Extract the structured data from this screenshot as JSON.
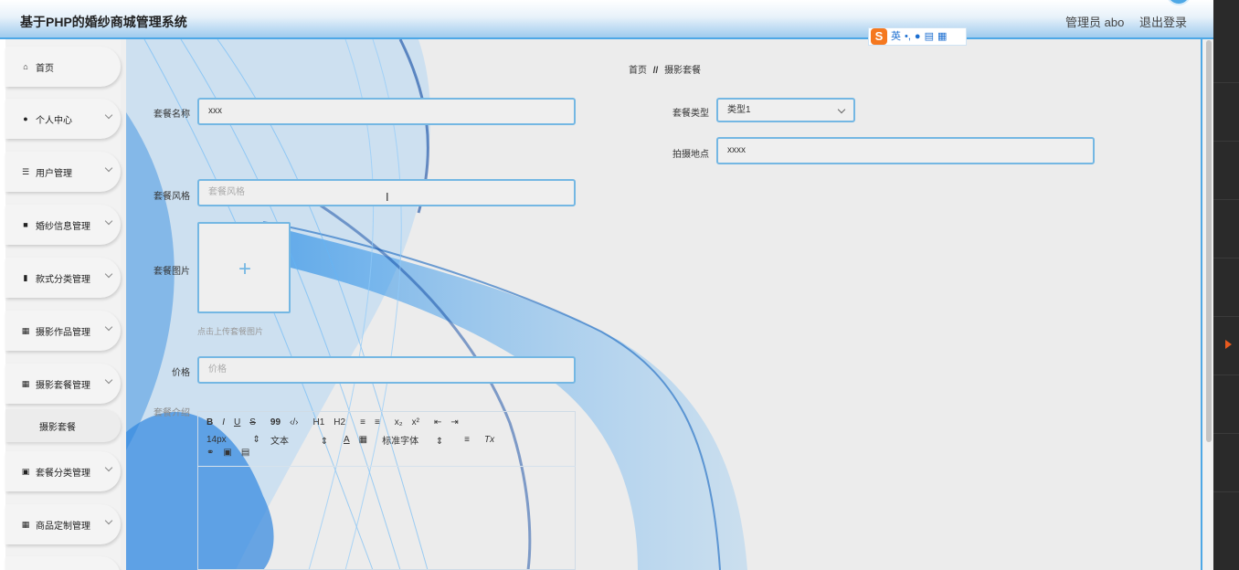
{
  "header": {
    "title": "基于PHP的婚纱商城管理系统",
    "user_label": "管理员 abo",
    "logout_label": "退出登录"
  },
  "ime_toolbar": {
    "logo": "S",
    "mode": "英",
    "punct": "•,"
  },
  "sidebar": {
    "items": [
      {
        "label": "首页",
        "icon": "home-icon",
        "expandable": false
      },
      {
        "label": "个人中心",
        "icon": "person-icon",
        "expandable": true
      },
      {
        "label": "用户管理",
        "icon": "list-icon",
        "expandable": true
      },
      {
        "label": "婚纱信息管理",
        "icon": "briefcase-icon",
        "expandable": true
      },
      {
        "label": "款式分类管理",
        "icon": "book-icon",
        "expandable": true
      },
      {
        "label": "摄影作品管理",
        "icon": "grid-icon",
        "expandable": true
      },
      {
        "label": "摄影套餐管理",
        "icon": "grid-icon",
        "expandable": true
      },
      {
        "label": "摄影套餐",
        "sub": true
      },
      {
        "label": "套餐分类管理",
        "icon": "clipboard-icon",
        "expandable": true
      },
      {
        "label": "商品定制管理",
        "icon": "grid-icon",
        "expandable": true
      }
    ]
  },
  "breadcrumb": {
    "home": "首页",
    "separator": "//",
    "current": "摄影套餐"
  },
  "form": {
    "name_label": "套餐名称",
    "name_value": "xxx",
    "type_label": "套餐类型",
    "type_value": "类型1",
    "location_label": "拍摄地点",
    "location_value": "xxxx",
    "style_label": "套餐风格",
    "style_placeholder": "套餐风格",
    "image_label": "套餐图片",
    "image_hint": "点击上传套餐图片",
    "price_label": "价格",
    "price_placeholder": "价格",
    "intro_label": "套餐介绍"
  },
  "editor_toolbar": {
    "row1": [
      "B",
      "I",
      "U",
      "S",
      "99",
      "‹/›",
      "H1",
      "H2",
      "≡",
      "≡",
      "x₂",
      "x²",
      "⇤",
      "⇥"
    ],
    "font_size": "14px",
    "text_type": "文本",
    "font_family": "标准字体",
    "clear_format": "Tx"
  },
  "colors": {
    "accent": "#4ea8e6",
    "field_border": "#74b7e3",
    "ime_orange": "#f5781f"
  }
}
